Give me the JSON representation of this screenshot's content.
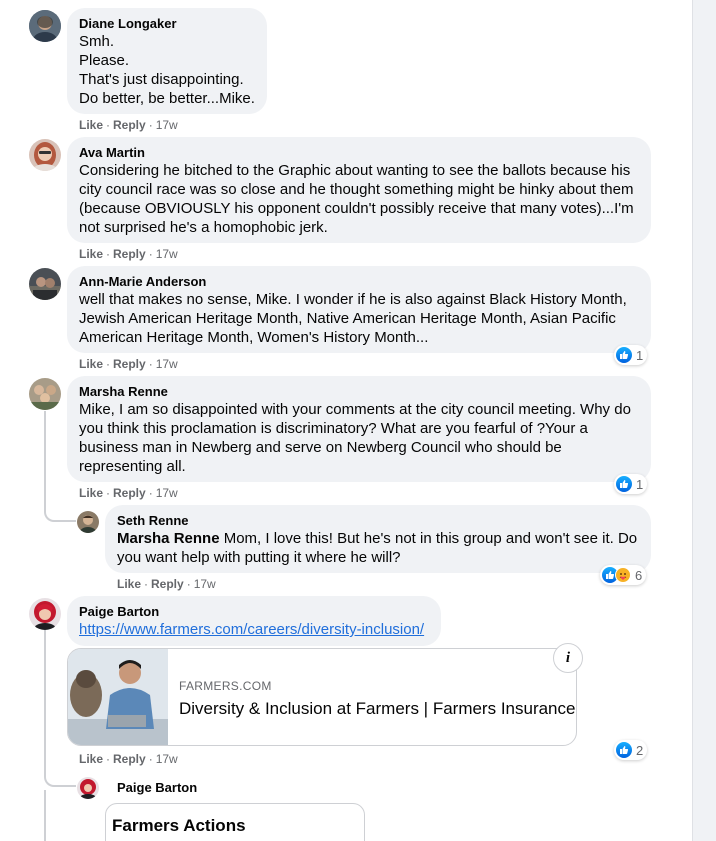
{
  "comments": [
    {
      "author": "Diane Longaker",
      "lines": [
        "Smh.",
        "Please.",
        "That's just disappointing.",
        "Do better, be better...Mike."
      ],
      "like": "Like",
      "reply": "Reply",
      "time": "17w"
    },
    {
      "author": "Ava Martin",
      "lines": [
        "Considering he bitched to the Graphic about wanting to see the ballots because his",
        "city council race was so close and he thought something might be hinky about them",
        "(because OBVIOUSLY his opponent couldn't possibly receive that many votes)...I'm",
        "not surprised he's a homophobic jerk."
      ],
      "like": "Like",
      "reply": "Reply",
      "time": "17w"
    },
    {
      "author": "Ann-Marie Anderson",
      "lines": [
        "well that makes no sense, Mike. I wonder if he is also against Black History Month,",
        "Jewish American Heritage Month, Native American Heritage Month, Asian Pacific",
        "American Heritage Month, Women's History Month..."
      ],
      "like": "Like",
      "reply": "Reply",
      "time": "17w",
      "reaction_count": "1"
    },
    {
      "author": "Marsha Renne",
      "lines": [
        "Mike, I am so disappointed with your comments at the city council meeting. Why do",
        "you think this proclamation is discriminatory? What are you fearful of ?Your a",
        "business man in Newberg and serve on Newberg Council who should be",
        "representing all."
      ],
      "like": "Like",
      "reply": "Reply",
      "time": "17w",
      "reaction_count": "1"
    },
    {
      "author": "Seth Renne",
      "mention": "Marsha Renne",
      "line1_rest": " Mom, I love this! But he's not in this group and won't see it. Do",
      "line2": "you want help with putting it where he will?",
      "like": "Like",
      "reply": "Reply",
      "time": "17w",
      "reaction_count": "6"
    },
    {
      "author": "Paige Barton",
      "link": "https://www.farmers.com/careers/diversity-inclusion/",
      "card": {
        "domain": "FARMERS.COM",
        "title": "Diversity & Inclusion at Farmers | Farmers Insurance",
        "info": "i"
      },
      "like": "Like",
      "reply": "Reply",
      "time": "17w",
      "reaction_count": "2"
    },
    {
      "author": "Paige Barton",
      "card_title": "Farmers Actions"
    }
  ],
  "colors": {
    "bubble": "#f0f2f5",
    "meta": "#65676b",
    "link": "#216fdb",
    "like_blue": "#0571ED"
  }
}
